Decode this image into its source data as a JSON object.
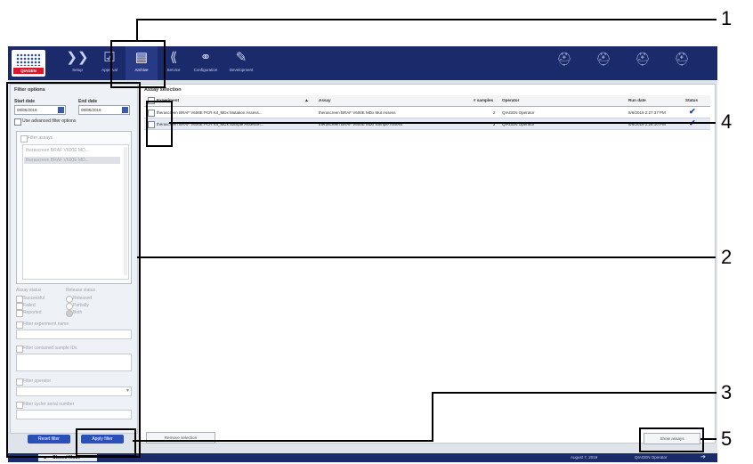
{
  "nav": {
    "setup": "Setup",
    "approval": "Approval",
    "archive": "Archive",
    "service": "Service",
    "configuration": "Configuration",
    "development": "Development"
  },
  "logo": "QIAGEN",
  "filter": {
    "title": "Filter options",
    "start_date_label": "Start date",
    "end_date_label": "End date",
    "start_date": "08/06/2019",
    "end_date": "08/06/2019",
    "advanced_label": "Use advanced filter options",
    "filter_assays": "Filter assays",
    "assay_list": [
      "therascreen BRAF V600E MD...",
      "therascreen BRAF V600E MD..."
    ],
    "assay_status_label": "Assay status",
    "release_status_label": "Release status",
    "assay_status_items": [
      "Successful",
      "Failed",
      "Reported"
    ],
    "release_status_items": [
      "Released",
      "Partially",
      "Both"
    ],
    "experiment_name": "Filter experiment name",
    "sample_ids": "Filter contained sample IDs",
    "operator": "Filter operator",
    "cycler_serial": "Filter cycler serial number",
    "reset_btn": "Reset filter",
    "apply_btn": "Apply filter"
  },
  "assay_selection": {
    "title": "Assay selection",
    "columns": [
      "Experiment",
      "Assay",
      "# samples",
      "Operator",
      "Run date",
      "Status"
    ],
    "rows": [
      {
        "experiment": "therascreen BRAF V600E PCR Kit_MDx Mutation Assess...",
        "assay": "therascreen BRAF V600E MDx Mut Assess",
        "samples": "2",
        "operator": "QIAGEN Operator",
        "run_date": "8/6/2019 2:27:37 PM"
      },
      {
        "experiment": "therascreen BRAF V600E PCR Kit_MDx Sample Assessm...",
        "assay": "therascreen BRAF V600E MDx Sample Assess",
        "samples": "2",
        "operator": "QIAGEN Operator",
        "run_date": "8/6/2019 2:26:10 PM"
      }
    ],
    "show_assays_btn": "Show assays",
    "bottom_btn": "Remove selection"
  },
  "statusbar": {
    "mode": "Closed Mode",
    "date": "August 7, 2019",
    "user": "QIAGEN Operator"
  },
  "callouts": [
    "1",
    "2",
    "3",
    "4",
    "5"
  ]
}
